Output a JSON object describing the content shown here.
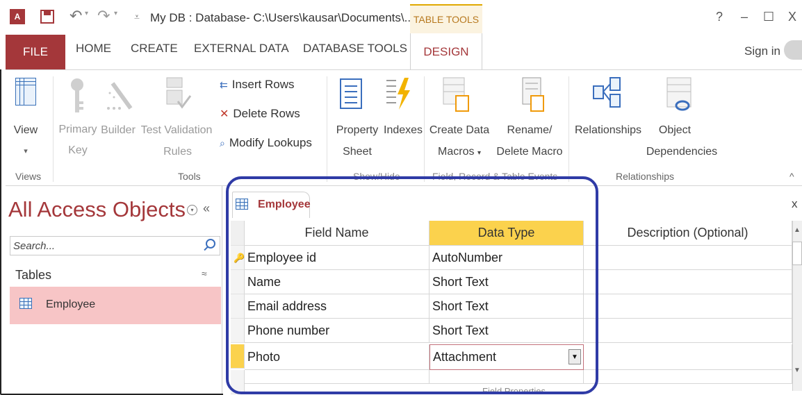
{
  "titlebar": {
    "app_icon": "A",
    "title": "My DB : Database- C:\\Users\\kausar\\Documents\\...",
    "context_tab": "TABLE TOOLS",
    "help": "?",
    "minimize": "–",
    "restore": "☐",
    "close": "X"
  },
  "tabs": {
    "file": "FILE",
    "home": "HOME",
    "create": "CREATE",
    "external": "EXTERNAL DATA",
    "dbtools": "DATABASE TOOLS",
    "design": "DESIGN",
    "signin": "Sign in"
  },
  "ribbon": {
    "view_label": "View",
    "primary_key_line1": "Primary",
    "primary_key_line2": "Key",
    "builder": "Builder",
    "test_validation_line1": "Test Validation",
    "test_validation_line2": "Rules",
    "insert_rows": "Insert Rows",
    "delete_rows": "Delete Rows",
    "modify_lookups": "Modify Lookups",
    "property_sheet_line1": "Property",
    "property_sheet_line2": "Sheet",
    "indexes": "Indexes",
    "create_data_macros_line1": "Create Data",
    "create_data_macros_line2": "Macros",
    "rename_delete_line1": "Rename/",
    "rename_delete_line2": "Delete Macro",
    "relationships": "Relationships",
    "object_dep_line1": "Object",
    "object_dep_line2": "Dependencies",
    "group_views": "Views",
    "group_tools": "Tools",
    "group_showhide": "Show/Hide",
    "group_field_events": "Field, Record & Table Events",
    "group_relationships": "Relationships",
    "collapse": "^"
  },
  "nav": {
    "title": "All Access Objects",
    "menu": "▾",
    "collapse": "«",
    "search_placeholder": "Search...",
    "section": "Tables",
    "section_toggle": "≈",
    "items": [
      {
        "label": "Employee"
      }
    ]
  },
  "doc": {
    "tab_label": "Employee",
    "close": "x",
    "columns": [
      "Field Name",
      "Data Type",
      "Description (Optional)"
    ],
    "rows": [
      {
        "field": "Employee id",
        "type": "AutoNumber",
        "desc": ""
      },
      {
        "field": "Name",
        "type": "Short Text",
        "desc": ""
      },
      {
        "field": "Email address",
        "type": "Short Text",
        "desc": ""
      },
      {
        "field": "Phone number",
        "type": "Short Text",
        "desc": ""
      },
      {
        "field": "Photo",
        "type": "Attachment",
        "desc": ""
      },
      {
        "field": "",
        "type": "",
        "desc": ""
      }
    ],
    "selected_row_index": 4,
    "footer_hint": "Field Properties"
  },
  "colors": {
    "accent": "#a4373a",
    "context_tab": "#e0a800",
    "highlight_ring": "#2f3ba6",
    "selected_nav": "#f7c5c6",
    "selected_header": "#fbd24d"
  }
}
